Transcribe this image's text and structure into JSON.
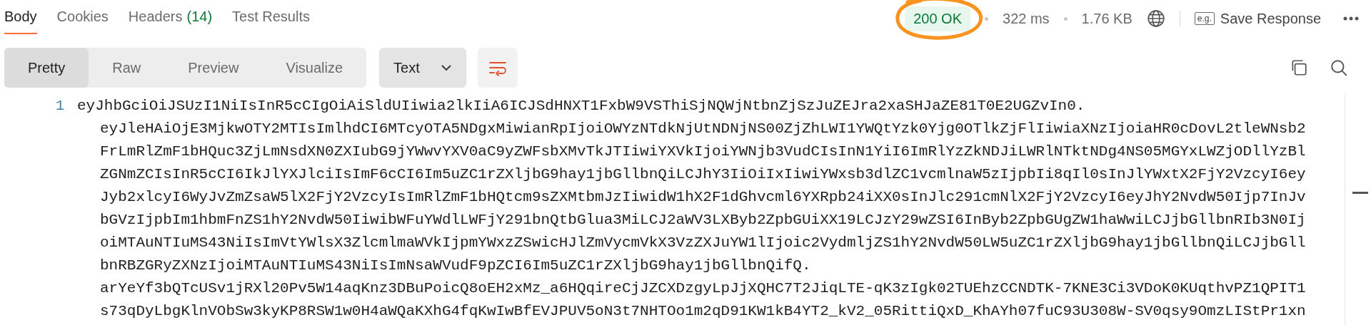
{
  "tabs": [
    {
      "label": "Body",
      "selected": true
    },
    {
      "label": "Cookies",
      "selected": false
    },
    {
      "label": "Headers",
      "count": "(14)",
      "selected": false
    },
    {
      "label": "Test Results",
      "selected": false
    }
  ],
  "status": {
    "code": "200 OK",
    "highlighted": true,
    "time": "322 ms",
    "size": "1.76 KB"
  },
  "save_response": {
    "icon_text": "e.g.",
    "label": "Save Response"
  },
  "view_modes": [
    {
      "label": "Pretty",
      "selected": true
    },
    {
      "label": "Raw",
      "selected": false
    },
    {
      "label": "Preview",
      "selected": false
    },
    {
      "label": "Visualize",
      "selected": false
    }
  ],
  "format": "Text",
  "wrap_lines": true,
  "body": {
    "line_number": "1",
    "lines": [
      "eyJhbGciOiJSUzI1NiIsInR5cCIgOiAiSldUIiwia2lkIiA6ICJSdHNXT1FxbW9VSThiSjNQWjNtbnZjSzJuZEJra2xaSHJaZE81T0E2UGZvIn0.",
      "eyJleHAiOjE3MjkwOTY2MTIsImlhdCI6MTcyOTA5NDgxMiwianRpIjoiOWYzNTdkNjUtNDNjNS00ZjZhLWI1YWQtYzk0Yjg0OTlkZjFlIiwiaXNzIjoiaHR0cDovL2tleWNsb2",
      "FrLmRlZmF1bHQuc3ZjLmNsdXN0ZXIubG9jYWwvYXV0aC9yZWFsbXMvTkJTIiwiYXVkIjoiYWNjb3VudCIsInN1YiI6ImRlYzZkNDJiLWRlNTktNDg4NS05MGYxLWZjODllYzBl",
      "ZGNmZCIsInR5cCI6IkJlYXJlciIsImF6cCI6Im5uZC1rZXljbG9hay1jbGllbnQiLCJhY3IiOiIxIiwiYWxsb3dlZC1vcmlnaW5zIjpbIi8qIl0sInJlYWxtX2FjY2VzcyI6ey",
      "Jyb2xlcyI6WyJvZmZsaW5lX2FjY2VzcyIsImRlZmF1bHQtcm9sZXMtbmJzIiwidW1hX2F1dGhvcml6YXRpb24iXX0sInJlc291cmNlX2FjY2VzcyI6eyJhY2NvdW50Ijp7InJv",
      "bGVzIjpbIm1hbmFnZS1hY2NvdW50IiwibWFuYWdlLWFjY291bnQtbGlua3MiLCJ2aWV3LXByb2ZpbGUiXX19LCJzY29wZSI6InByb2ZpbGUgZW1haWwiLCJjbGllbnRIb3N0Ij",
      "oiMTAuNTIuMS43NiIsImVtYWlsX3ZlcmlmaWVkIjpmYWxzZSwicHJlZmVycmVkX3VzZXJuYW1lIjoic2VydmljZS1hY2NvdW50LW5uZC1rZXljbG9hay1jbGllbnQiLCJjbGll",
      "bnRBZGRyZXNzIjoiMTAuNTIuMS43NiIsImNsaWVudF9pZCI6Im5uZC1rZXljbG9hay1jbGllbnQifQ.",
      "arYeYf3bQTcUSv1jRXl20Pv5W14aqKnz3DBuPoicQ8oEH2xMz_a6HQqireCjJZCXDzgyLpJjXQHC7T2JiqLTE-qK3zIgk02TUEhzCCNDTK-7KNE3Ci3VDoK0KUqthvPZ1QPIT1",
      "s73qDyLbgKlnVObSw3kyKP8RSW1w0H4aWQaKXhG4fqKwIwBfEVJPUV5oN3t7NHTOo1m2qD91KW1kB4YT2_kV2_05RittiQxD_KhAYh07fuC93U308W-SV0qsy9OmzLIStPr1xn"
    ]
  }
}
